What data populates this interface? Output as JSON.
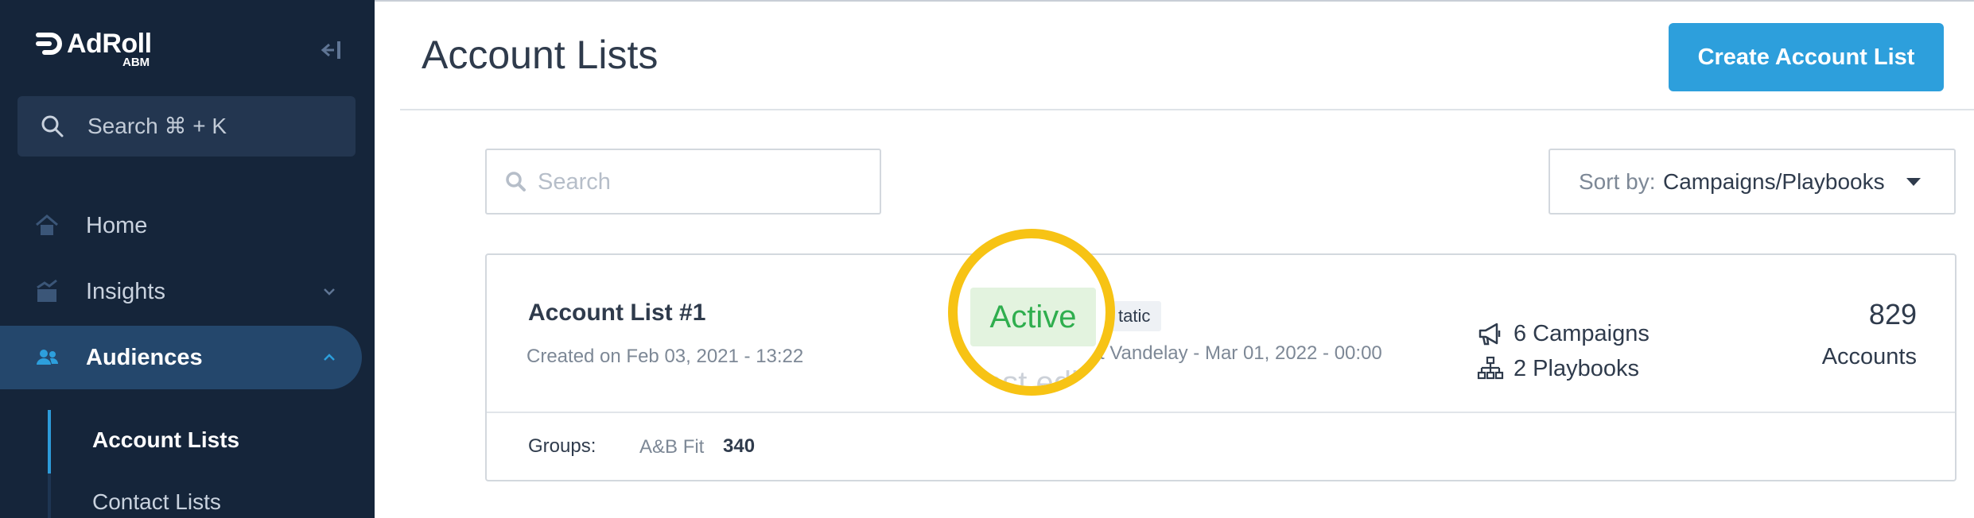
{
  "app": {
    "logo_text": "AdRoll",
    "logo_sub": "ABM"
  },
  "sidebar": {
    "search_label": "Search ⌘ + K",
    "items": [
      {
        "label": "Home",
        "icon": "home-icon"
      },
      {
        "label": "Insights",
        "icon": "insights-icon"
      },
      {
        "label": "Audiences",
        "icon": "audiences-icon"
      }
    ],
    "sub_items": [
      {
        "label": "Account Lists"
      },
      {
        "label": "Contact Lists"
      }
    ]
  },
  "header": {
    "title": "Account Lists",
    "create_button": "Create Account List"
  },
  "filters": {
    "search_placeholder": "Search",
    "sort_prefix": "Sort by:",
    "sort_value": "Campaigns/Playbooks"
  },
  "card": {
    "name": "Account List #1",
    "created": "Created on Feb 03, 2021 - 13:22",
    "status": "Active",
    "type_badge": "tatic",
    "last_edited": "rt Vandelay - Mar 01, 2022 - 00:00",
    "ghost_text": "ast edi",
    "campaigns": "6 Campaigns",
    "playbooks": "2 Playbooks",
    "accounts_count": "829",
    "accounts_label": "Accounts",
    "groups_label": "Groups:",
    "group_name": "A&B Fit",
    "group_count": "340"
  },
  "colors": {
    "sidebar_bg": "#15253a",
    "accent_blue": "#2d9fdc",
    "highlight_yellow": "#f7c314",
    "active_green": "#2fae4e"
  }
}
